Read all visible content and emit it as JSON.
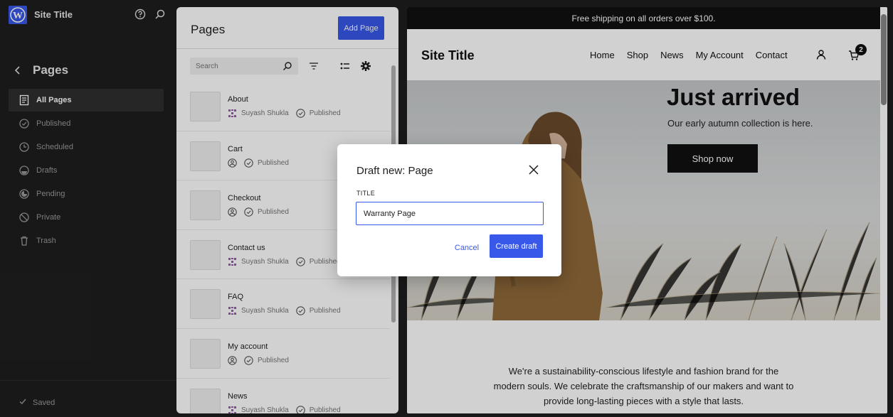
{
  "sidebar": {
    "site_title": "Site Title",
    "heading": "Pages",
    "items": [
      {
        "label": "All Pages",
        "icon": "pages-icon",
        "active": true
      },
      {
        "label": "Published",
        "icon": "published-icon"
      },
      {
        "label": "Scheduled",
        "icon": "scheduled-icon"
      },
      {
        "label": "Drafts",
        "icon": "drafts-icon"
      },
      {
        "label": "Pending",
        "icon": "pending-icon"
      },
      {
        "label": "Private",
        "icon": "private-icon"
      },
      {
        "label": "Trash",
        "icon": "trash-icon"
      }
    ],
    "status": "Saved"
  },
  "pages_panel": {
    "title": "Pages",
    "add_button": "Add Page",
    "search_placeholder": "Search",
    "rows": [
      {
        "title": "About",
        "author": "Suyash Shukla",
        "status": "Published"
      },
      {
        "title": "Cart",
        "author": "",
        "status": "Published"
      },
      {
        "title": "Checkout",
        "author": "",
        "status": "Published"
      },
      {
        "title": "Contact us",
        "author": "Suyash Shukla",
        "status": "Published"
      },
      {
        "title": "FAQ",
        "author": "Suyash Shukla",
        "status": "Published"
      },
      {
        "title": "My account",
        "author": "",
        "status": "Published"
      },
      {
        "title": "News",
        "author": "Suyash Shukla",
        "status": "Published"
      }
    ]
  },
  "preview": {
    "banner": "Free shipping on all orders over $100.",
    "site_title": "Site Title",
    "nav": [
      "Home",
      "Shop",
      "News",
      "My Account",
      "Contact"
    ],
    "cart_count": "2",
    "hero_heading": "Just arrived",
    "hero_sub": "Our early autumn collection is here.",
    "hero_button": "Shop now",
    "about_text": "We're a sustainability-conscious lifestyle and fashion brand for the modern souls. We celebrate the craftsmanship of our makers and want to provide long-lasting pieces with a style that lasts."
  },
  "modal": {
    "title": "Draft new: Page",
    "field_label": "TITLE",
    "field_value": "Warranty Page",
    "cancel": "Cancel",
    "create": "Create draft"
  },
  "colors": {
    "accent": "#3858e9",
    "sidebar_bg": "#1e1e1e"
  }
}
